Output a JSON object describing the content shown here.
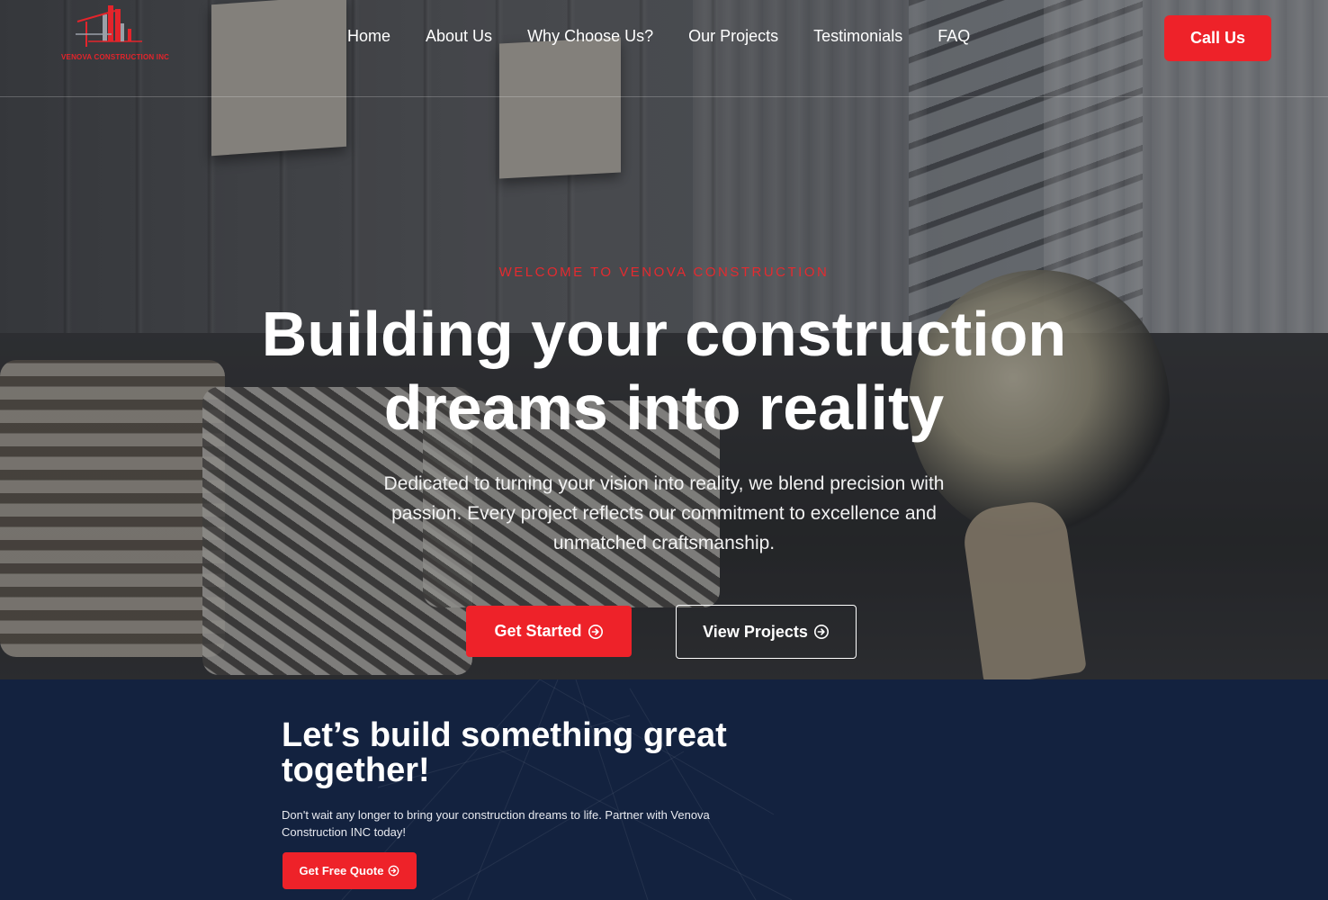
{
  "brand": {
    "logo_text": "VENOVA CONSTRUCTION INC",
    "accent_color": "#ee2229",
    "dark_navy": "#13223f"
  },
  "nav": {
    "items": [
      {
        "label": "Home"
      },
      {
        "label": "About Us"
      },
      {
        "label": "Why Choose Us?"
      },
      {
        "label": "Our Projects"
      },
      {
        "label": "Testimonials"
      },
      {
        "label": "FAQ"
      }
    ],
    "call_label": "Call Us"
  },
  "hero": {
    "eyebrow": "WELCOME TO VENOVA CONSTRUCTION",
    "headline_line1": "Building your construction",
    "headline_line2": "dreams into reality",
    "subtext": "Dedicated to turning your vision into reality, we blend precision with passion. Every project reflects our commitment to excellence and unmatched craftsmanship.",
    "primary_button": "Get Started",
    "secondary_button": "View Projects",
    "button_icon": "arrow-circle-right-icon"
  },
  "cta": {
    "title": "Let’s build something great together!",
    "text": "Don't wait any longer to bring your construction dreams to life. Partner with Venova Construction INC today!",
    "button": "Get Free Quote"
  }
}
